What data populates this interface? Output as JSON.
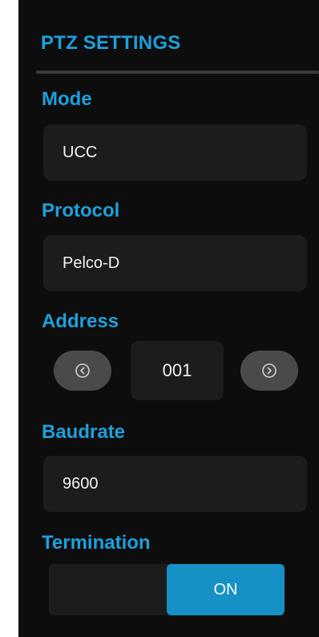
{
  "panel": {
    "title": "PTZ SETTINGS"
  },
  "mode": {
    "label": "Mode",
    "value": "UCC"
  },
  "protocol": {
    "label": "Protocol",
    "value": "Pelco-D"
  },
  "address": {
    "label": "Address",
    "value": "001",
    "prev_icon": "chevron-left-circle-icon",
    "next_icon": "chevron-right-circle-icon"
  },
  "baudrate": {
    "label": "Baudrate",
    "value": "9600"
  },
  "termination": {
    "label": "Termination",
    "state_label": "ON",
    "state": "on"
  },
  "colors": {
    "accent": "#1ea0dc",
    "toggle_on": "#1591c6",
    "panel_bg": "#0d0d0d",
    "field_bg": "#1c1c1c",
    "button_bg": "#4a4a4a"
  }
}
